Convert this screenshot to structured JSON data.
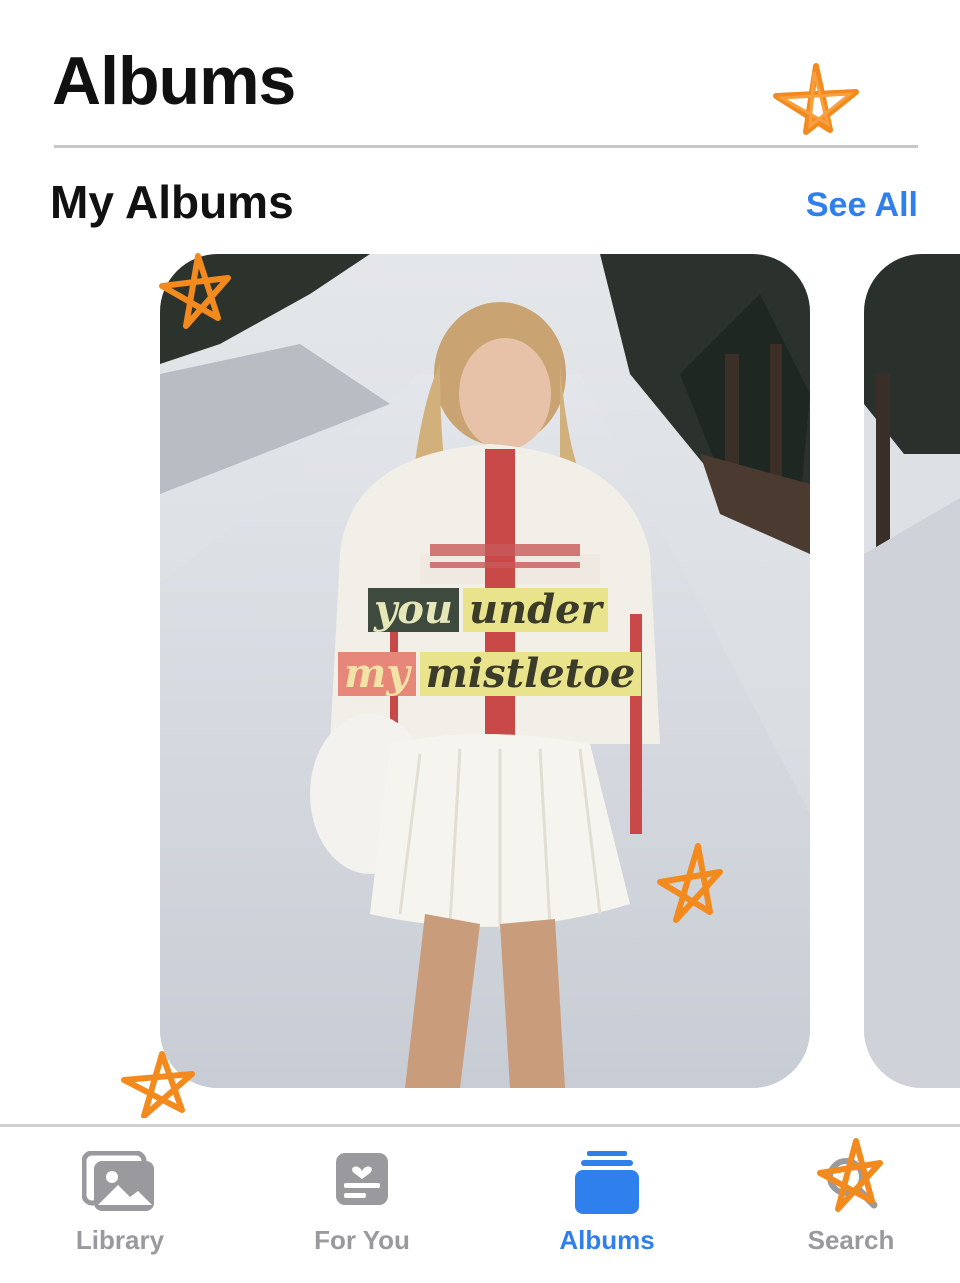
{
  "header": {
    "title": "Albums"
  },
  "section": {
    "title": "My Albums",
    "see_all_label": "See All"
  },
  "album": {
    "caption_line1": [
      "you",
      "under"
    ],
    "caption_line2": [
      "my",
      "mistletoe"
    ]
  },
  "tabs": [
    {
      "label": "Library",
      "icon": "photo-library-icon",
      "active": false
    },
    {
      "label": "For You",
      "icon": "for-you-icon",
      "active": false
    },
    {
      "label": "Albums",
      "icon": "albums-stack-icon",
      "active": true
    },
    {
      "label": "Search",
      "icon": "search-icon",
      "active": false
    }
  ],
  "colors": {
    "accent": "#2f80ed",
    "inactive": "#9a9a9e",
    "star": "#f28a1e"
  }
}
